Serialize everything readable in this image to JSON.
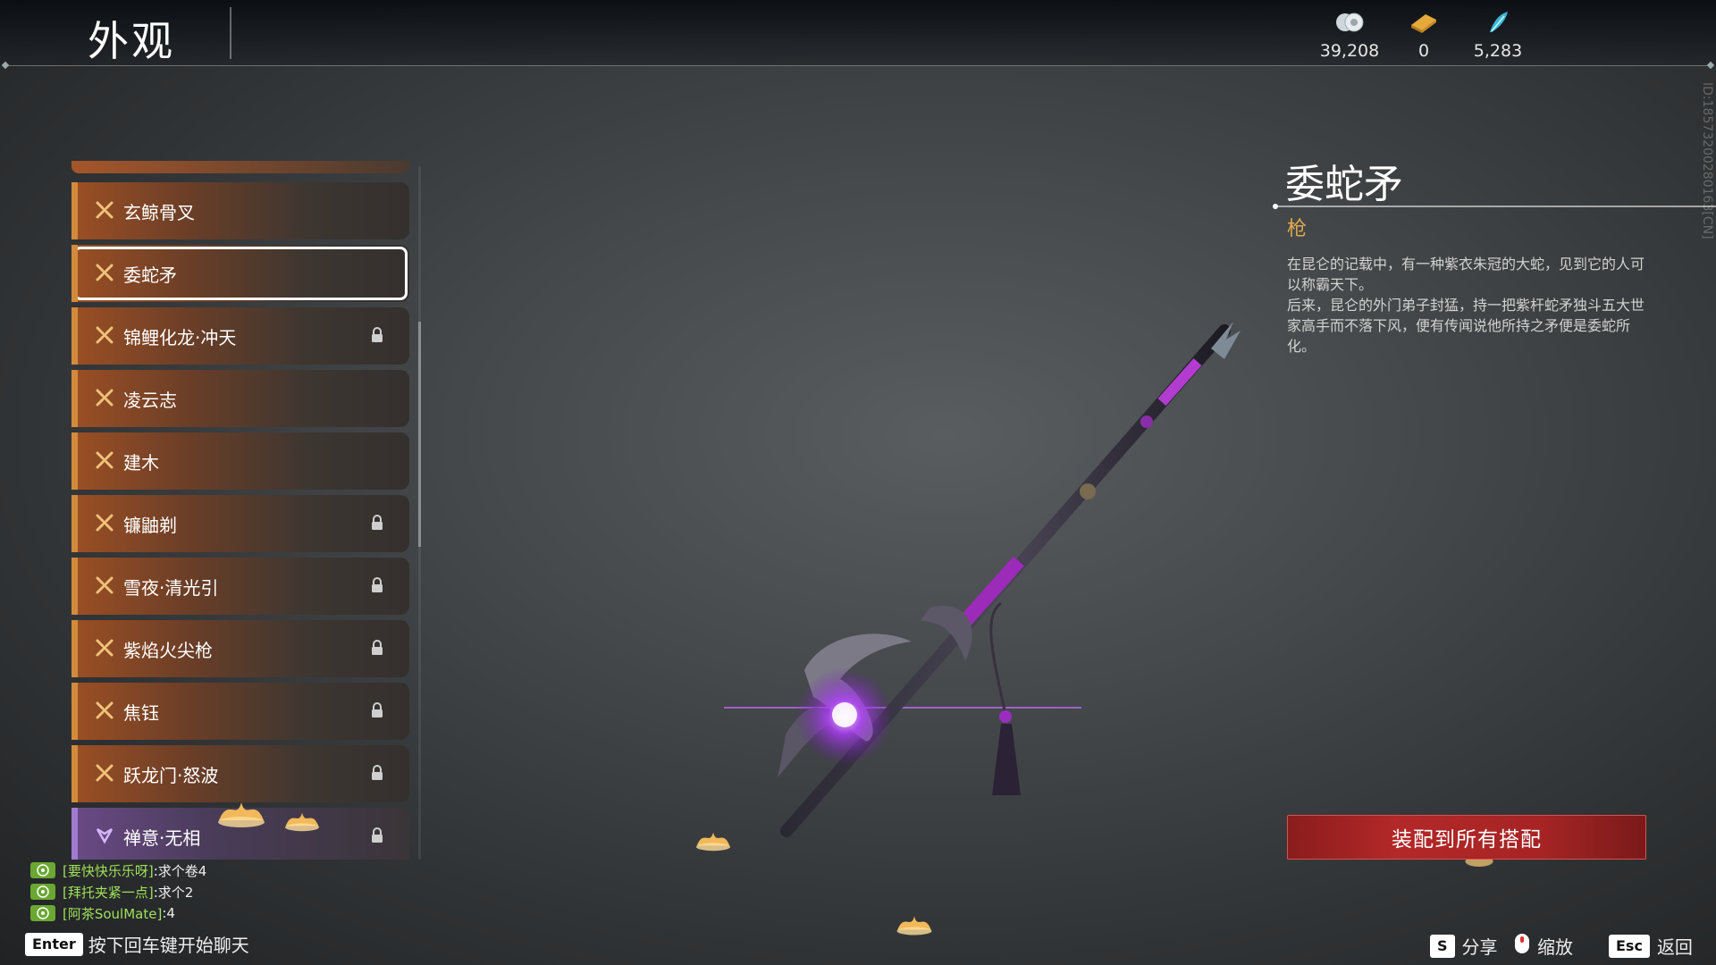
{
  "header": {
    "title": "外观",
    "currencies": [
      {
        "icon": "coin-icon",
        "value": "39,208"
      },
      {
        "icon": "ticket-icon",
        "value": "0"
      },
      {
        "icon": "feather-icon",
        "value": "5,283"
      }
    ],
    "id_text": "ID:1857320028016З[CN]"
  },
  "list": {
    "items": [
      {
        "label": "玄鲸骨叉",
        "locked": false,
        "selected": false,
        "rarity": "orange"
      },
      {
        "label": "委蛇矛",
        "locked": false,
        "selected": true,
        "rarity": "orange"
      },
      {
        "label": "锦鲤化龙·冲天",
        "locked": true,
        "selected": false,
        "rarity": "orange"
      },
      {
        "label": "凌云志",
        "locked": false,
        "selected": false,
        "rarity": "orange"
      },
      {
        "label": "建木",
        "locked": false,
        "selected": false,
        "rarity": "orange"
      },
      {
        "label": "镰鼬剃",
        "locked": true,
        "selected": false,
        "rarity": "orange"
      },
      {
        "label": "雪夜·清光引",
        "locked": true,
        "selected": false,
        "rarity": "orange"
      },
      {
        "label": "紫焰火尖枪",
        "locked": true,
        "selected": false,
        "rarity": "orange"
      },
      {
        "label": "焦钰",
        "locked": true,
        "selected": false,
        "rarity": "orange"
      },
      {
        "label": "跃龙门·怒波",
        "locked": true,
        "selected": false,
        "rarity": "orange"
      },
      {
        "label": "禅意·无相",
        "locked": true,
        "selected": false,
        "rarity": "purple"
      }
    ]
  },
  "detail": {
    "name": "委蛇矛",
    "type": "枪",
    "description": [
      "在昆仑的记载中，有一种紫衣朱冠的大蛇，见到它的人可以称霸天下。",
      "后来，昆仑的外门弟子封猛，持一把紫杆蛇矛独斗五大世家高手而不落下风，便有传闻说他所持之矛便是委蛇所化。"
    ],
    "equip_button": "装配到所有搭配"
  },
  "chat": {
    "lines": [
      {
        "name": "[要快快乐乐呀]",
        "msg": ":求个卷4"
      },
      {
        "name": "[拜托夹紧一点]",
        "msg": ":求个2"
      },
      {
        "name": "[阿茶SoulMate]",
        "msg": ":4"
      }
    ],
    "enter_key": "Enter",
    "enter_hint": "按下回车键开始聊天"
  },
  "hints": {
    "share_key": "S",
    "share_label": "分享",
    "zoom_label": "缩放",
    "back_key": "Esc",
    "back_label": "返回"
  },
  "colors": {
    "accent_orange": "#d28a3c",
    "accent_purple": "#a27ad0",
    "type_gold": "#e0a94f",
    "equip_red": "#b32828",
    "chat_green": "#9fe05a"
  }
}
